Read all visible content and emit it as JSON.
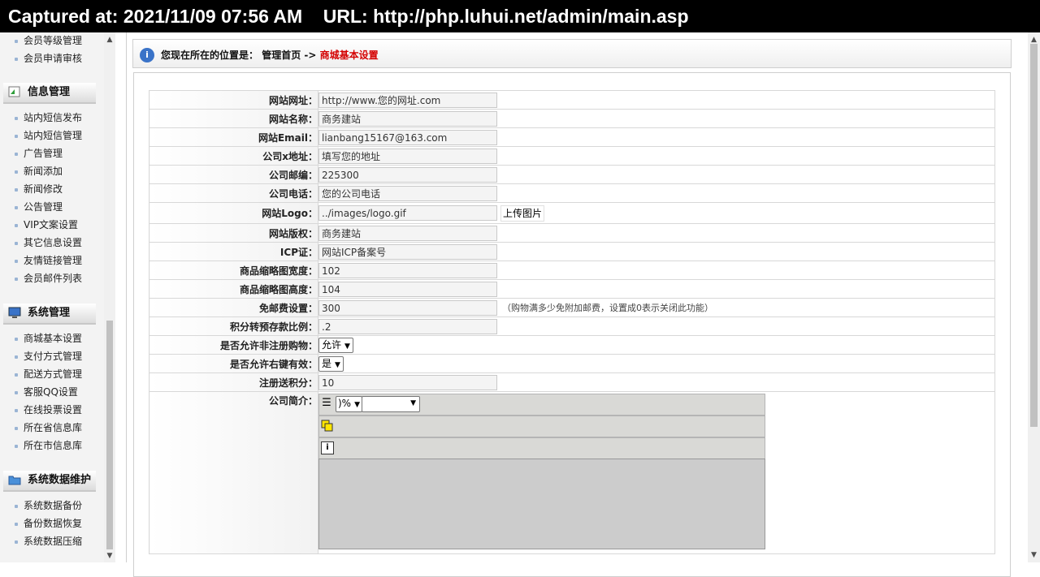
{
  "capture": {
    "text": "Captured at: 2021/11/09 07:56 AM    URL: http://php.luhui.net/admin/main.asp"
  },
  "sidebar": {
    "top_items": [
      "会员等级管理",
      "会员申请审核"
    ],
    "groups": [
      {
        "title": "信息管理",
        "icon": "news-icon",
        "items": [
          "站内短信发布",
          "站内短信管理",
          "广告管理",
          "新闻添加",
          "新闻修改",
          "公告管理",
          "VIP文案设置",
          "其它信息设置",
          "友情链接管理",
          "会员邮件列表"
        ]
      },
      {
        "title": "系统管理",
        "icon": "monitor-icon",
        "items": [
          "商城基本设置",
          "支付方式管理",
          "配送方式管理",
          "客服QQ设置",
          "在线投票设置",
          "所在省信息库",
          "所在市信息库"
        ]
      },
      {
        "title": "系统数据维护",
        "icon": "folder-icon",
        "items": [
          "系统数据备份",
          "备份数据恢复",
          "系统数据压缩"
        ]
      }
    ]
  },
  "location": {
    "prefix": "您现在所在的位置是：",
    "home": "管理首页",
    "sep": " -> ",
    "current": "商城基本设置"
  },
  "form": {
    "rows": [
      {
        "label": "网站网址：",
        "value": "http://www.您的网址.com"
      },
      {
        "label": "网站名称：",
        "value": "商务建站"
      },
      {
        "label": "网站Email：",
        "value": "lianbang15167@163.com"
      },
      {
        "label": "公司x地址：",
        "value": "填写您的地址"
      },
      {
        "label": "公司邮编：",
        "value": "225300"
      },
      {
        "label": "公司电话：",
        "value": "您的公司电话"
      },
      {
        "label": "网站Logo：",
        "value": "../images/logo.gif",
        "button": "上传图片"
      },
      {
        "label": "网站版权：",
        "value": "商务建站"
      },
      {
        "label": "ICP证：",
        "value": "网站ICP备案号"
      },
      {
        "label": "商品缩略图宽度：",
        "value": "102"
      },
      {
        "label": "商品缩略图高度：",
        "value": "104"
      },
      {
        "label": "免邮费设置：",
        "value": "300",
        "note": "（购物满多少免附加邮费，设置成0表示关闭此功能）"
      },
      {
        "label": "积分转预存款比例：",
        "value": ".2"
      }
    ],
    "allow_unregistered": {
      "label": "是否允许非注册购物：",
      "value": "允许"
    },
    "allow_rightclick": {
      "label": "是否允许右键有效：",
      "value": "是"
    },
    "register_points": {
      "label": "注册送积分：",
      "value": "10"
    },
    "company_intro": {
      "label": "公司简介：",
      "zoom": ")%",
      "format": ""
    }
  }
}
